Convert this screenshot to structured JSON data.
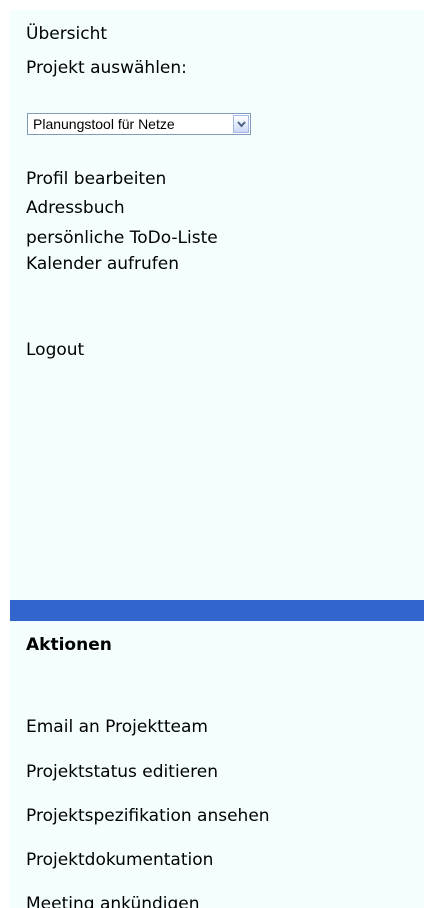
{
  "nav": {
    "overview": "Übersicht",
    "project_select_label": "Projekt auswählen:",
    "project_select_value": "Planungstool für Netze",
    "links": [
      "Profil bearbeiten",
      "Adressbuch",
      "persönliche ToDo-Liste",
      "Kalender aufrufen"
    ],
    "logout": "Logout"
  },
  "actions": {
    "title": "Aktionen",
    "items": [
      "Email an Projektteam",
      "Projektstatus editieren",
      "Projektspezifikation ansehen",
      "Projektdokumentation",
      "Meeting ankündigen"
    ]
  },
  "colors": {
    "panel_bg": "#f5fefe",
    "divider": "#3366cc"
  }
}
